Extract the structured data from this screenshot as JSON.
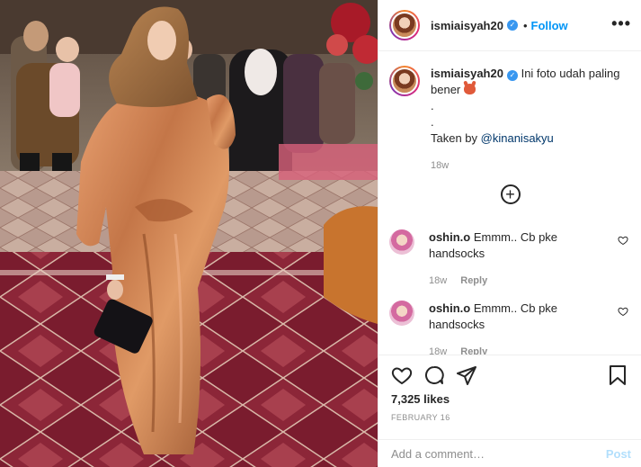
{
  "post": {
    "image_alt": "Woman in a copper satin dress and brown hijab standing on a patterned red carpet at an event",
    "author": {
      "username": "ismiaisyah20",
      "verified": true,
      "follow_label": "Follow",
      "dot": "•"
    },
    "more_label": "•••",
    "caption": {
      "username": "ismiaisyah20",
      "text": "Ini foto udah paling bener",
      "dot1": ".",
      "dot2": ".",
      "taken_by_prefix": "Taken by ",
      "mention": "@kinanisakyu",
      "time": "18w"
    },
    "load_more_label": "+",
    "comments": [
      {
        "username": "oshin.o",
        "text": "Emmm.. Cb pke handsocks",
        "time": "18w",
        "reply_label": "Reply"
      },
      {
        "username": "oshin.o",
        "text": "Emmm.. Cb pke handsocks",
        "time": "18w",
        "reply_label": "Reply"
      }
    ],
    "likes": "7,325 likes",
    "date": "FEBRUARY 16",
    "add_comment": {
      "placeholder": "Add a comment…",
      "post_label": "Post"
    },
    "colors": {
      "follow": "#0095f6",
      "verified": "#3897f0",
      "post_disabled": "#b2dffc",
      "muted": "#8e8e8e",
      "text": "#262626"
    }
  }
}
